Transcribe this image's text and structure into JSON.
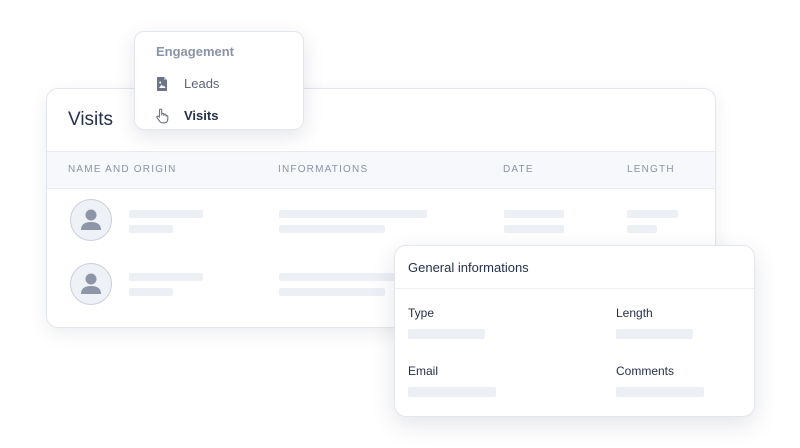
{
  "menu": {
    "heading": "Engagement",
    "items": [
      {
        "label": "Leads",
        "icon": "file-document-icon",
        "active": false
      },
      {
        "label": "Visits",
        "icon": "hand-pointer-icon",
        "active": true
      }
    ]
  },
  "visits": {
    "title": "Visits",
    "columns": [
      "NAME AND ORIGIN",
      "INFORMATIONS",
      "DATE",
      "LENGTH"
    ],
    "row_count": 2
  },
  "info_panel": {
    "title": "General informations",
    "fields": {
      "type": "Type",
      "length": "Length",
      "email": "Email",
      "comments": "Comments"
    }
  },
  "colors": {
    "text_dark": "#27304a",
    "text_muted": "#8a93a6",
    "skeleton": "#eceff4",
    "avatar_glyph": "#8d96a8"
  }
}
